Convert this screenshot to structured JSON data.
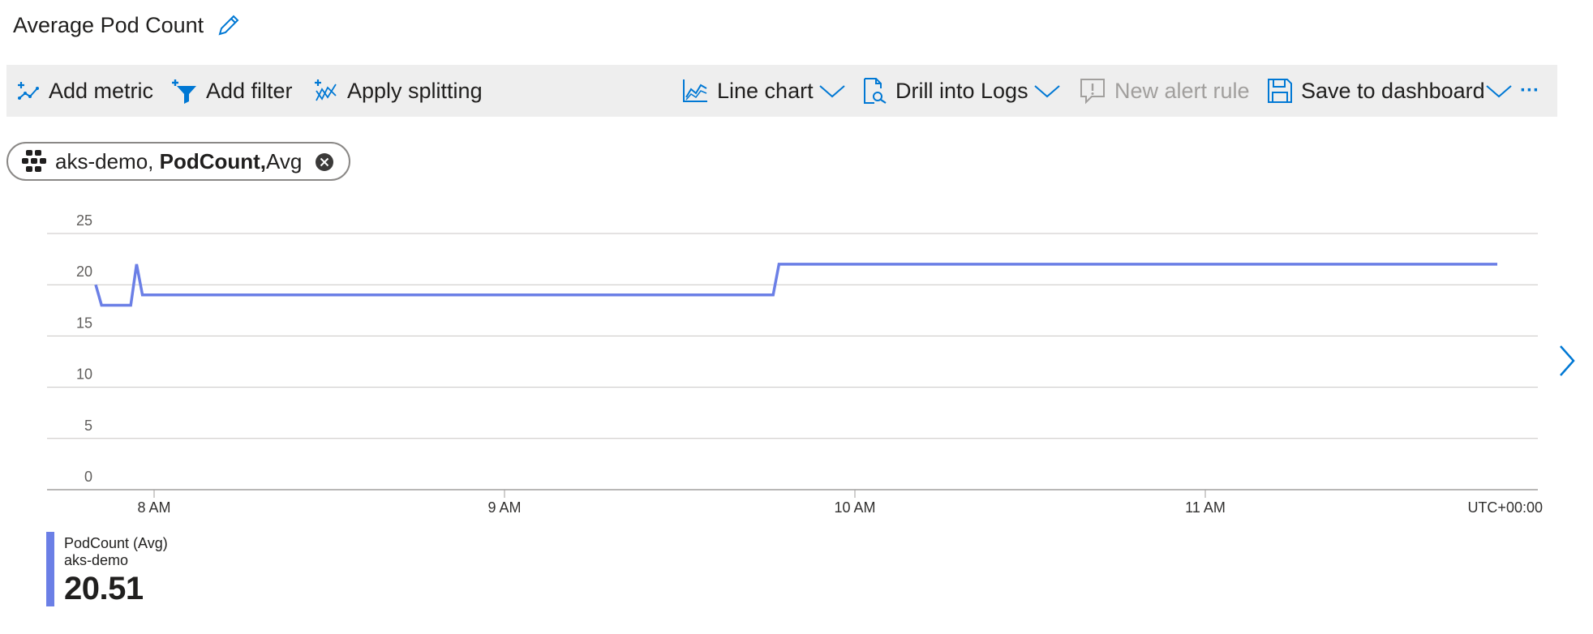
{
  "header": {
    "title": "Average Pod Count",
    "edit_icon": "pencil-icon"
  },
  "toolbar": {
    "add_metric": "Add metric",
    "add_filter": "Add filter",
    "apply_splitting": "Apply splitting",
    "line_chart": "Line chart",
    "drill_into_logs": "Drill into Logs",
    "new_alert_rule": "New alert rule",
    "save_to_dashboard": "Save to dashboard",
    "more": "···"
  },
  "metric_pill": {
    "resource": "aks-demo,",
    "metric": "PodCount,",
    "aggregation": "Avg"
  },
  "chart_data": {
    "type": "line",
    "x_unit": "time of day",
    "x_ticks": [
      "8 AM",
      "9 AM",
      "10 AM",
      "11 AM"
    ],
    "timezone": "UTC+00:00",
    "ylim": [
      0,
      25
    ],
    "y_ticks": [
      "0",
      "5",
      "10",
      "15",
      "20",
      "25"
    ],
    "grid": true,
    "series": [
      {
        "name": "PodCount (Avg)",
        "color": "#6b7fe6",
        "x": [
          "07:50",
          "07:51",
          "07:56",
          "07:57",
          "07:58",
          "07:59",
          "09:46",
          "09:47",
          "11:50"
        ],
        "y": [
          20,
          18,
          18,
          22,
          19,
          19,
          19,
          22,
          22
        ]
      }
    ]
  },
  "legend": {
    "series": "PodCount (Avg)",
    "resource": "aks-demo",
    "value": "20.51"
  },
  "colors": {
    "accent": "#0078d4",
    "series": "#6b7fe6",
    "toolbar_bg": "#eeeeee"
  }
}
